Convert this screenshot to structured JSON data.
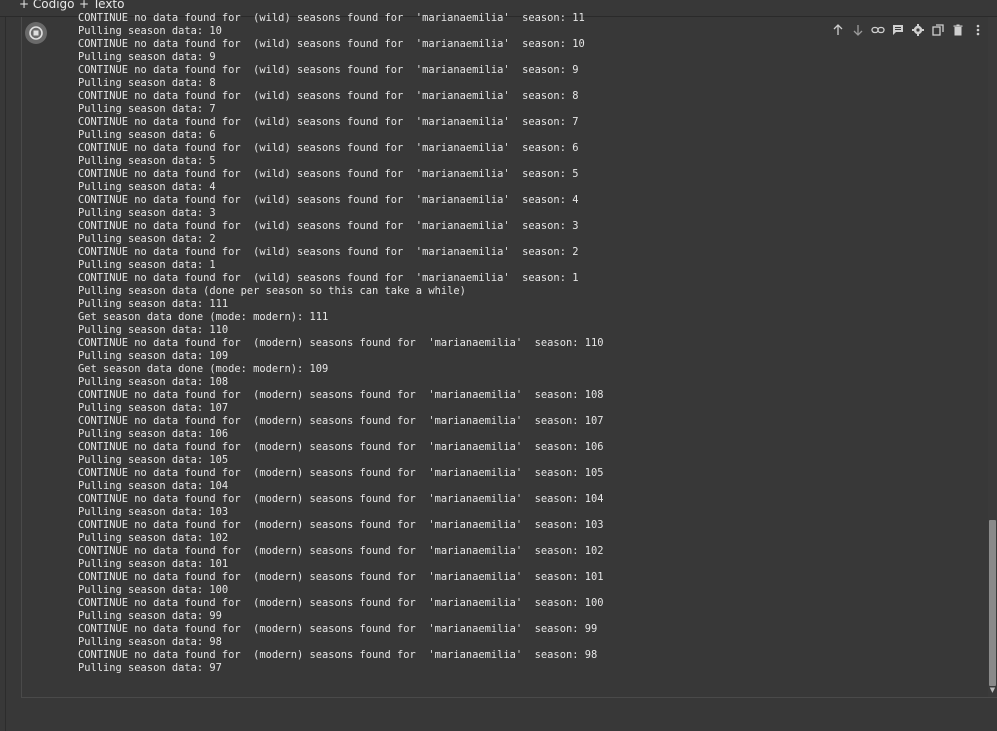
{
  "toolbar_top": {
    "add_code_label": "+ Código",
    "add_text_label": "+ Texto"
  },
  "cell_toolbar": {
    "icons": [
      "arrow-up-icon",
      "arrow-down-icon",
      "link-icon",
      "comment-icon",
      "gear-icon",
      "mirror-cell-icon",
      "delete-icon",
      "more-vert-icon"
    ]
  },
  "output_lines": [
    "CONTINUE no data found for  (wild) seasons found for  'marianaemilia'  season: 11",
    "Pulling season data: 10",
    "CONTINUE no data found for  (wild) seasons found for  'marianaemilia'  season: 10",
    "Pulling season data: 9",
    "CONTINUE no data found for  (wild) seasons found for  'marianaemilia'  season: 9",
    "Pulling season data: 8",
    "CONTINUE no data found for  (wild) seasons found for  'marianaemilia'  season: 8",
    "Pulling season data: 7",
    "CONTINUE no data found for  (wild) seasons found for  'marianaemilia'  season: 7",
    "Pulling season data: 6",
    "CONTINUE no data found for  (wild) seasons found for  'marianaemilia'  season: 6",
    "Pulling season data: 5",
    "CONTINUE no data found for  (wild) seasons found for  'marianaemilia'  season: 5",
    "Pulling season data: 4",
    "CONTINUE no data found for  (wild) seasons found for  'marianaemilia'  season: 4",
    "Pulling season data: 3",
    "CONTINUE no data found for  (wild) seasons found for  'marianaemilia'  season: 3",
    "Pulling season data: 2",
    "CONTINUE no data found for  (wild) seasons found for  'marianaemilia'  season: 2",
    "Pulling season data: 1",
    "CONTINUE no data found for  (wild) seasons found for  'marianaemilia'  season: 1",
    "Pulling season data (done per season so this can take a while)",
    "Pulling season data: 111",
    "Get season data done (mode: modern): 111",
    "Pulling season data: 110",
    "CONTINUE no data found for  (modern) seasons found for  'marianaemilia'  season: 110",
    "Pulling season data: 109",
    "Get season data done (mode: modern): 109",
    "Pulling season data: 108",
    "CONTINUE no data found for  (modern) seasons found for  'marianaemilia'  season: 108",
    "Pulling season data: 107",
    "CONTINUE no data found for  (modern) seasons found for  'marianaemilia'  season: 107",
    "Pulling season data: 106",
    "CONTINUE no data found for  (modern) seasons found for  'marianaemilia'  season: 106",
    "Pulling season data: 105",
    "CONTINUE no data found for  (modern) seasons found for  'marianaemilia'  season: 105",
    "Pulling season data: 104",
    "CONTINUE no data found for  (modern) seasons found for  'marianaemilia'  season: 104",
    "Pulling season data: 103",
    "CONTINUE no data found for  (modern) seasons found for  'marianaemilia'  season: 103",
    "Pulling season data: 102",
    "CONTINUE no data found for  (modern) seasons found for  'marianaemilia'  season: 102",
    "Pulling season data: 101",
    "CONTINUE no data found for  (modern) seasons found for  'marianaemilia'  season: 101",
    "Pulling season data: 100",
    "CONTINUE no data found for  (modern) seasons found for  'marianaemilia'  season: 100",
    "Pulling season data: 99",
    "CONTINUE no data found for  (modern) seasons found for  'marianaemilia'  season: 99",
    "Pulling season data: 98",
    "CONTINUE no data found for  (modern) seasons found for  'marianaemilia'  season: 98",
    "Pulling season data: 97"
  ],
  "colors": {
    "background": "#383838",
    "text": "#e6e6e6",
    "scrollbar_thumb": "#8a8a8a"
  }
}
